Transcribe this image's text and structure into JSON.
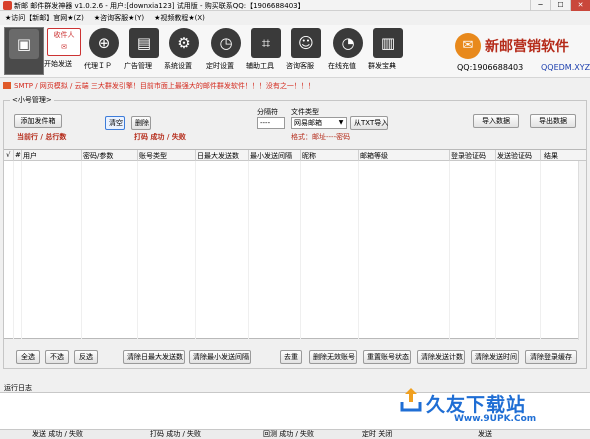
{
  "window": {
    "title": "新邮 邮件群发神器 v1.0.2.6 - 用户:[downxia123] 试用版 - 购买联系QQ:【1906688403】"
  },
  "menu": [
    "★访问【新邮】官网★(Z)",
    "★咨询客服★(Y)",
    "★视频教程★(X)"
  ],
  "toolbar": [
    {
      "label": "",
      "icon": "user-list-icon"
    },
    {
      "label": "开始发送",
      "icon": "send-envelope-icon",
      "badge": "收件人"
    },
    {
      "label": "代理ＩＰ",
      "icon": "globe-icon"
    },
    {
      "label": "广告管理",
      "icon": "ad-icon"
    },
    {
      "label": "系统设置",
      "icon": "gear-icon"
    },
    {
      "label": "定时设置",
      "icon": "compass-icon"
    },
    {
      "label": "辅助工具",
      "icon": "network-icon"
    },
    {
      "label": "咨询客服",
      "icon": "contact-card-icon"
    },
    {
      "label": "在线充值",
      "icon": "pie-chart-icon"
    },
    {
      "label": "群发宝典",
      "icon": "books-icon"
    }
  ],
  "brand": {
    "name": "新邮营销软件",
    "qq": "QQ:1906688403",
    "site": "QQEDM.XYZ"
  },
  "notice": "SMTP / 网页模拟 / 云端 三大群发引擎！目前市面上最强大的邮件群发软件！！！没有之一！！！",
  "panel": {
    "group_title": "小号管理",
    "add_button": "添加发件箱",
    "clear_button": "清空",
    "delete_button": "删除",
    "row_status": "当前行 / 总行数",
    "hit_status": "打码 成功 / 失败",
    "separator_label": "分隔符",
    "separator_value": "----",
    "file_type_label": "文件类型",
    "file_type_value": "网易邮箱",
    "import_txt": "从TXT导入",
    "format_hint": "格式：邮址----密码",
    "import_data": "导入数据",
    "export_data": "导出数据"
  },
  "table": {
    "columns": [
      "√",
      "#",
      "用户",
      "密码/参数",
      "账号类型",
      "日最大发送数",
      "最小发送间隔",
      "昵称",
      "邮箱等级",
      "登录验证码",
      "发送验证码",
      "结果"
    ]
  },
  "bottom_buttons": [
    "全选",
    "不选",
    "反选",
    "清除日最大发送数",
    "清除最小发送间隔",
    "去重",
    "删除无效账号",
    "重置账号状态",
    "清除发送计数",
    "清除发送时间",
    "清除登录缓存"
  ],
  "log": {
    "title": "运行日志"
  },
  "statusbar": [
    "发送 成功 / 失败",
    "打码 成功 / 失败",
    "回测 成功 / 失败",
    "定时 关闭",
    "发送"
  ],
  "watermark": {
    "name": "久友下载站",
    "url": "Www.9UPK.Com"
  }
}
